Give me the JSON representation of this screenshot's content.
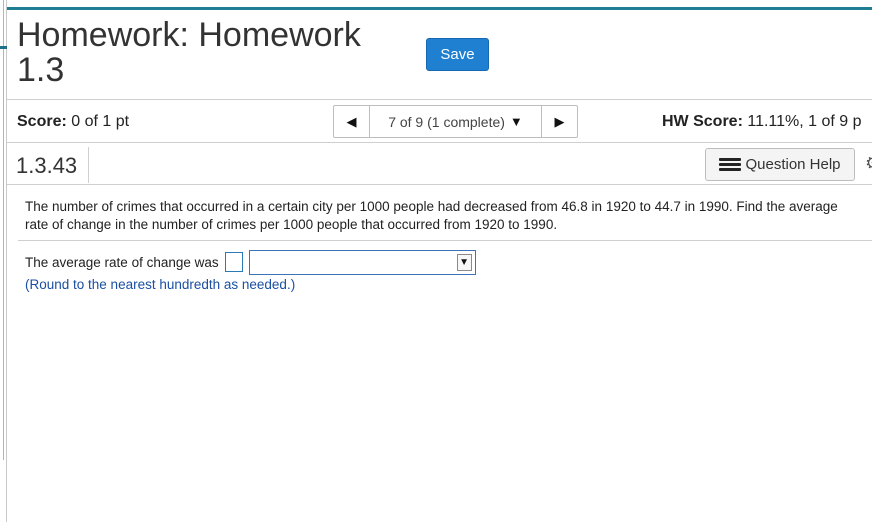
{
  "header": {
    "title": "Homework: Homework 1.3",
    "save_label": "Save"
  },
  "score_row": {
    "score_label": "Score:",
    "score_value": "0 of 1 pt",
    "nav_prev": "◀",
    "nav_progress": "7 of 9 (1 complete)",
    "nav_caret": "▼",
    "nav_next": "▶",
    "hw_score_label": "HW Score:",
    "hw_score_value": "11.11%, 1 of 9 p"
  },
  "question": {
    "number": "1.3.43",
    "help_label": "Question Help",
    "text": "The number of crimes that occurred in a certain city per 1000 people had decreased from 46.8 in 1920 to 44.7 in 1990. Find the average rate of change in the number of crimes per 1000 people that occurred from 1920 to 1990.",
    "answer_prefix": "The average rate of change was",
    "answer_value": "",
    "dropdown_selected": "",
    "dropdown_arrow": "▼",
    "hint": "(Round to the nearest hundredth as needed.)"
  },
  "colors": {
    "accent_bar": "#1f7e94",
    "save_button": "#1f7fd0",
    "hint_text": "#1a4fa3"
  }
}
